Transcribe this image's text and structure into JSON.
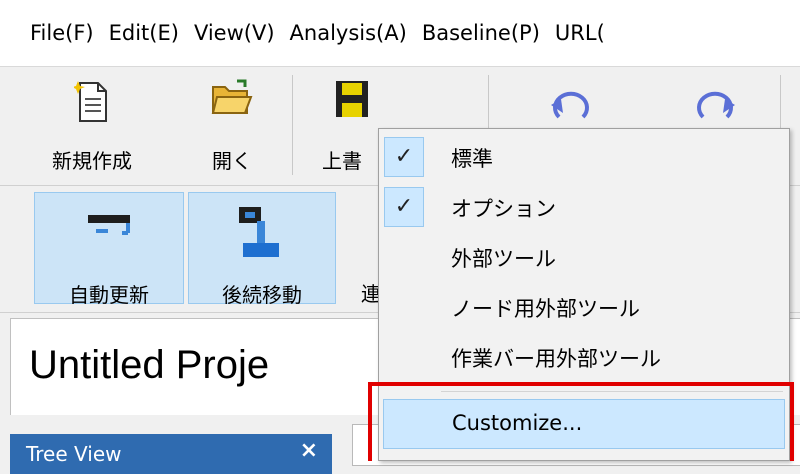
{
  "menubar": {
    "items": [
      "File(F)",
      "Edit(E)",
      "View(V)",
      "Analysis(A)",
      "Baseline(P)",
      "URL("
    ]
  },
  "toolbar1": {
    "new_label": "新規作成",
    "open_label": "開く",
    "save_label": "上書"
  },
  "toolbar2": {
    "auto_update_label": "自動更新",
    "follow_move_label": "後続移動",
    "partial_label": "連"
  },
  "project": {
    "title": "Untitled Proje"
  },
  "tree_view": {
    "title": "Tree View",
    "close": "×"
  },
  "context_menu": {
    "items": [
      {
        "label": "標準",
        "checked": true
      },
      {
        "label": "オプション",
        "checked": true
      },
      {
        "label": "外部ツール",
        "checked": false
      },
      {
        "label": "ノード用外部ツール",
        "checked": false
      },
      {
        "label": "作業バー用外部ツール",
        "checked": false
      }
    ],
    "customize_label": "Customize...",
    "check_glyph": "✓"
  },
  "colors": {
    "highlight": "#cce8ff",
    "callout_red": "#e00000",
    "tree_view_header": "#2f6bb0"
  }
}
